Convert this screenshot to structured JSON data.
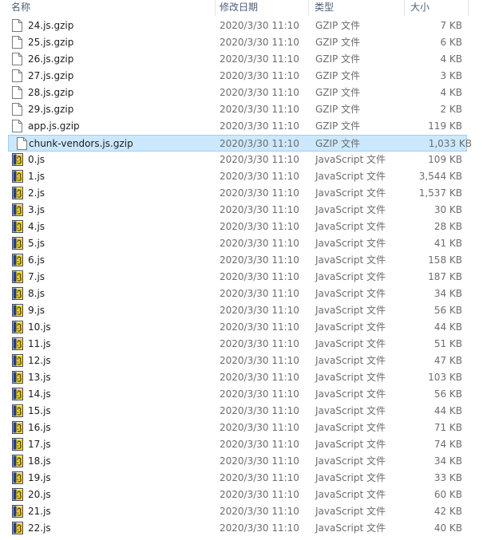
{
  "columns": {
    "name": "名称",
    "date": "修改日期",
    "type": "类型",
    "size": "大小"
  },
  "files": [
    {
      "name": "24.js.gzip",
      "date": "2020/3/30 11:10",
      "type": "GZIP 文件",
      "size": "7 KB",
      "icon": "generic-file-icon",
      "selected": false
    },
    {
      "name": "25.js.gzip",
      "date": "2020/3/30 11:10",
      "type": "GZIP 文件",
      "size": "6 KB",
      "icon": "generic-file-icon",
      "selected": false
    },
    {
      "name": "26.js.gzip",
      "date": "2020/3/30 11:10",
      "type": "GZIP 文件",
      "size": "4 KB",
      "icon": "generic-file-icon",
      "selected": false
    },
    {
      "name": "27.js.gzip",
      "date": "2020/3/30 11:10",
      "type": "GZIP 文件",
      "size": "3 KB",
      "icon": "generic-file-icon",
      "selected": false
    },
    {
      "name": "28.js.gzip",
      "date": "2020/3/30 11:10",
      "type": "GZIP 文件",
      "size": "4 KB",
      "icon": "generic-file-icon",
      "selected": false
    },
    {
      "name": "29.js.gzip",
      "date": "2020/3/30 11:10",
      "type": "GZIP 文件",
      "size": "2 KB",
      "icon": "generic-file-icon",
      "selected": false
    },
    {
      "name": "app.js.gzip",
      "date": "2020/3/30 11:10",
      "type": "GZIP 文件",
      "size": "119 KB",
      "icon": "generic-file-icon",
      "selected": false
    },
    {
      "name": "chunk-vendors.js.gzip",
      "date": "2020/3/30 11:10",
      "type": "GZIP 文件",
      "size": "1,033 KB",
      "icon": "generic-file-icon",
      "selected": true
    },
    {
      "name": "0.js",
      "date": "2020/3/30 11:10",
      "type": "JavaScript 文件",
      "size": "109 KB",
      "icon": "javascript-file-icon",
      "selected": false
    },
    {
      "name": "1.js",
      "date": "2020/3/30 11:10",
      "type": "JavaScript 文件",
      "size": "3,544 KB",
      "icon": "javascript-file-icon",
      "selected": false
    },
    {
      "name": "2.js",
      "date": "2020/3/30 11:10",
      "type": "JavaScript 文件",
      "size": "1,537 KB",
      "icon": "javascript-file-icon",
      "selected": false
    },
    {
      "name": "3.js",
      "date": "2020/3/30 11:10",
      "type": "JavaScript 文件",
      "size": "30 KB",
      "icon": "javascript-file-icon",
      "selected": false
    },
    {
      "name": "4.js",
      "date": "2020/3/30 11:10",
      "type": "JavaScript 文件",
      "size": "28 KB",
      "icon": "javascript-file-icon",
      "selected": false
    },
    {
      "name": "5.js",
      "date": "2020/3/30 11:10",
      "type": "JavaScript 文件",
      "size": "41 KB",
      "icon": "javascript-file-icon",
      "selected": false
    },
    {
      "name": "6.js",
      "date": "2020/3/30 11:10",
      "type": "JavaScript 文件",
      "size": "158 KB",
      "icon": "javascript-file-icon",
      "selected": false
    },
    {
      "name": "7.js",
      "date": "2020/3/30 11:10",
      "type": "JavaScript 文件",
      "size": "187 KB",
      "icon": "javascript-file-icon",
      "selected": false
    },
    {
      "name": "8.js",
      "date": "2020/3/30 11:10",
      "type": "JavaScript 文件",
      "size": "34 KB",
      "icon": "javascript-file-icon",
      "selected": false
    },
    {
      "name": "9.js",
      "date": "2020/3/30 11:10",
      "type": "JavaScript 文件",
      "size": "56 KB",
      "icon": "javascript-file-icon",
      "selected": false
    },
    {
      "name": "10.js",
      "date": "2020/3/30 11:10",
      "type": "JavaScript 文件",
      "size": "44 KB",
      "icon": "javascript-file-icon",
      "selected": false
    },
    {
      "name": "11.js",
      "date": "2020/3/30 11:10",
      "type": "JavaScript 文件",
      "size": "51 KB",
      "icon": "javascript-file-icon",
      "selected": false
    },
    {
      "name": "12.js",
      "date": "2020/3/30 11:10",
      "type": "JavaScript 文件",
      "size": "47 KB",
      "icon": "javascript-file-icon",
      "selected": false
    },
    {
      "name": "13.js",
      "date": "2020/3/30 11:10",
      "type": "JavaScript 文件",
      "size": "103 KB",
      "icon": "javascript-file-icon",
      "selected": false
    },
    {
      "name": "14.js",
      "date": "2020/3/30 11:10",
      "type": "JavaScript 文件",
      "size": "56 KB",
      "icon": "javascript-file-icon",
      "selected": false
    },
    {
      "name": "15.js",
      "date": "2020/3/30 11:10",
      "type": "JavaScript 文件",
      "size": "44 KB",
      "icon": "javascript-file-icon",
      "selected": false
    },
    {
      "name": "16.js",
      "date": "2020/3/30 11:10",
      "type": "JavaScript 文件",
      "size": "71 KB",
      "icon": "javascript-file-icon",
      "selected": false
    },
    {
      "name": "17.js",
      "date": "2020/3/30 11:10",
      "type": "JavaScript 文件",
      "size": "74 KB",
      "icon": "javascript-file-icon",
      "selected": false
    },
    {
      "name": "18.js",
      "date": "2020/3/30 11:10",
      "type": "JavaScript 文件",
      "size": "34 KB",
      "icon": "javascript-file-icon",
      "selected": false
    },
    {
      "name": "19.js",
      "date": "2020/3/30 11:10",
      "type": "JavaScript 文件",
      "size": "33 KB",
      "icon": "javascript-file-icon",
      "selected": false
    },
    {
      "name": "20.js",
      "date": "2020/3/30 11:10",
      "type": "JavaScript 文件",
      "size": "60 KB",
      "icon": "javascript-file-icon",
      "selected": false
    },
    {
      "name": "21.js",
      "date": "2020/3/30 11:10",
      "type": "JavaScript 文件",
      "size": "42 KB",
      "icon": "javascript-file-icon",
      "selected": false
    },
    {
      "name": "22.js",
      "date": "2020/3/30 11:10",
      "type": "JavaScript 文件",
      "size": "40 KB",
      "icon": "javascript-file-icon",
      "selected": false
    }
  ],
  "colors": {
    "header_text": "#4c607a",
    "selection_fill": "#cce8ff",
    "selection_border": "#99d1ff",
    "secondary_text": "#6d6d6d",
    "primary_text": "#1e1e1e"
  }
}
